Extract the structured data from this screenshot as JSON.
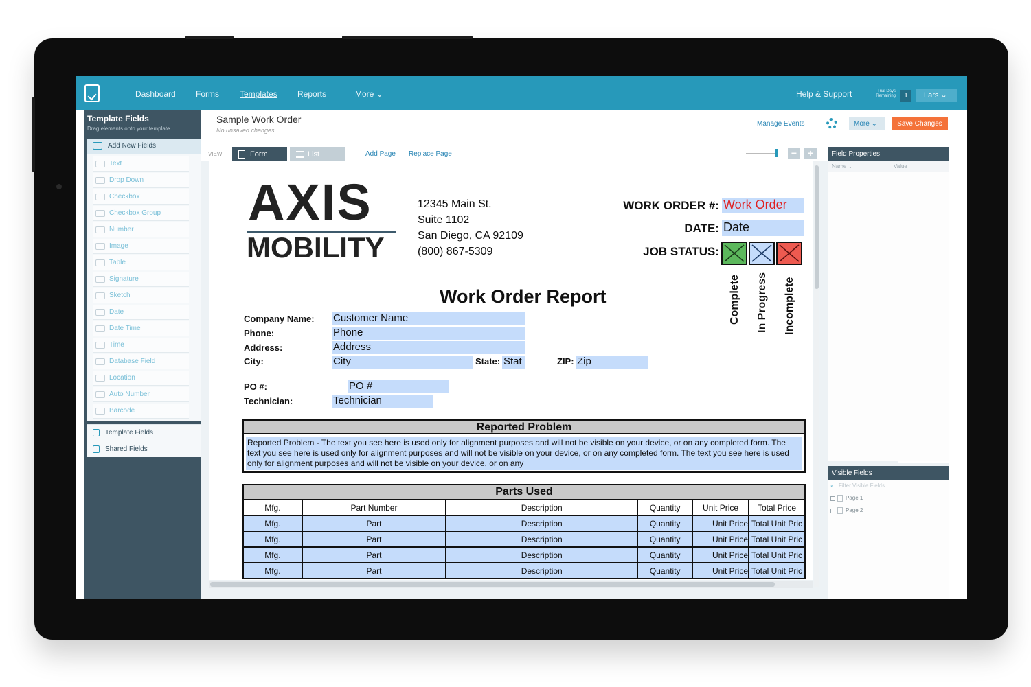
{
  "nav": {
    "items": [
      "Dashboard",
      "Forms",
      "Templates",
      "Reports",
      "More"
    ],
    "active": "Templates",
    "help": "Help & Support",
    "trial_label_1": "Trial Days",
    "trial_label_2": "Remaining",
    "trial_count": "1",
    "user": "Lars"
  },
  "left_panel": {
    "title": "Template Fields",
    "subtitle": "Drag elements onto your template",
    "add_new": "Add New Fields",
    "fields": [
      "Text",
      "Drop Down",
      "Checkbox",
      "Checkbox Group",
      "Number",
      "Image",
      "Table",
      "Signature",
      "Sketch",
      "Date",
      "Date Time",
      "Time",
      "Database Field",
      "Location",
      "Auto Number",
      "Barcode"
    ],
    "template_fields": "Template Fields",
    "shared_fields": "Shared Fields"
  },
  "header": {
    "title": "Sample Work Order",
    "subtitle": "No unsaved changes",
    "manage_events": "Manage Events",
    "more": "More",
    "save": "Save Changes"
  },
  "toolbar": {
    "view": "VIEW",
    "tab_form": "Form",
    "tab_list": "List",
    "add_page": "Add Page",
    "replace_page": "Replace Page",
    "zoom_out": "−",
    "zoom_in": "+"
  },
  "document": {
    "logo_top": "AXIS",
    "logo_bottom": "MOBILITY",
    "address": [
      "12345 Main St.",
      "Suite 1102",
      "San Diego, CA 92109",
      "(800) 867-5309"
    ],
    "wo_label": "WORK ORDER #:",
    "wo_value": "Work Order",
    "date_label": "DATE:",
    "date_value": "Date",
    "job_status_label": "JOB STATUS:",
    "status_labels": [
      "Complete",
      "In Progress",
      "Incomplete"
    ],
    "report_title": "Work Order Report",
    "company_label": "Company Name:",
    "company_value": "Customer Name",
    "phone_label": "Phone:",
    "phone_value": "Phone",
    "address_label": "Address:",
    "address_value": "Address",
    "city_label": "City:",
    "city_value": "City",
    "state_label": "State:",
    "state_value": "Stat",
    "zip_label": "ZIP:",
    "zip_value": "Zip",
    "po_label": "PO #:",
    "po_value": "PO #",
    "tech_label": "Technician:",
    "tech_value": "Technician",
    "problem_title": "Reported Problem",
    "problem_text": "Reported Problem - The text you see here is used only for alignment purposes and will not be visible on your device, or on any completed form. The text you see here is used only for alignment purposes and will not be visible on your device, or on any completed form. The text you see here is used only for alignment purposes and will not be visible on your device, or on any",
    "parts_title": "Parts Used",
    "parts_headers": [
      "Mfg.",
      "Part Number",
      "Description",
      "Quantity",
      "Unit Price",
      "Total Price"
    ],
    "parts_row": [
      "Mfg.",
      "Part",
      "Description",
      "Quantity",
      "Unit Price",
      "Total Unit Pric"
    ]
  },
  "right_panel": {
    "title": "Field Properties",
    "col_name": "Name",
    "col_value": "Value",
    "visible_title": "Visible Fields",
    "filter_placeholder": "Filter Visible Fields",
    "pages": [
      "Page 1",
      "Page 2"
    ]
  },
  "colors": {
    "nav": "#2799ba",
    "panel": "#3e5563",
    "save": "#f4723a",
    "field": "#c5dcfb",
    "status_complete": "#5cb85c",
    "status_progress": "#c5dcfb",
    "status_incomplete": "#ee5a50"
  }
}
